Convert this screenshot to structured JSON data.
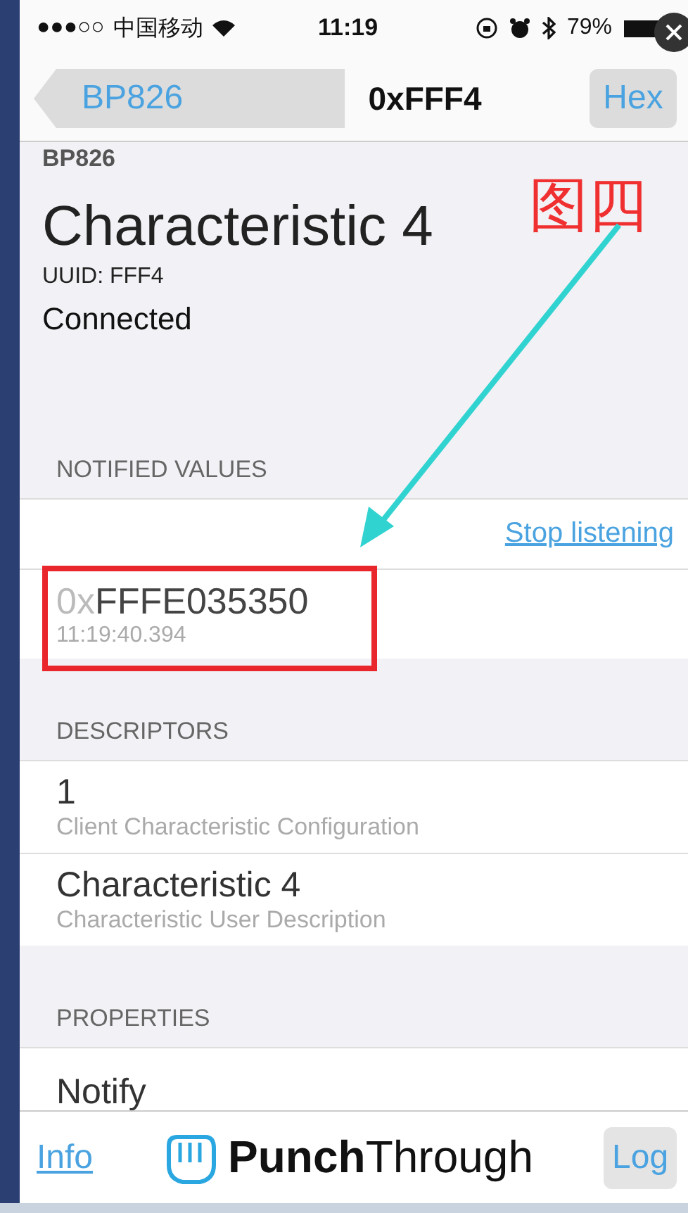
{
  "status_bar": {
    "signal": "●●●○○",
    "carrier": "中国移动",
    "time": "11:19",
    "battery": "79%"
  },
  "nav_bar": {
    "back": "BP826",
    "title": "0xFFF4",
    "right_button": "Hex"
  },
  "header": {
    "device": "BP826",
    "title": "Characteristic 4",
    "uuid": "UUID: FFF4",
    "state": "Connected"
  },
  "notified_values": {
    "heading": "NOTIFIED VALUES",
    "action": "Stop listening",
    "values": [
      {
        "prefix": "0x",
        "value": "FFFE035350",
        "time": "11:19:40.394"
      }
    ]
  },
  "descriptors": {
    "heading": "DESCRIPTORS",
    "items": [
      {
        "value": "1",
        "description": "Client Characteristic Configuration"
      },
      {
        "value": "Characteristic 4",
        "description": "Characteristic User Description"
      }
    ]
  },
  "properties": {
    "heading": "PROPERTIES",
    "items": [
      "Notify"
    ]
  },
  "toolbar": {
    "left": "Info",
    "brand": "**Punch**Through",
    "right": "Log"
  },
  "annotation": {
    "label": "图四"
  }
}
